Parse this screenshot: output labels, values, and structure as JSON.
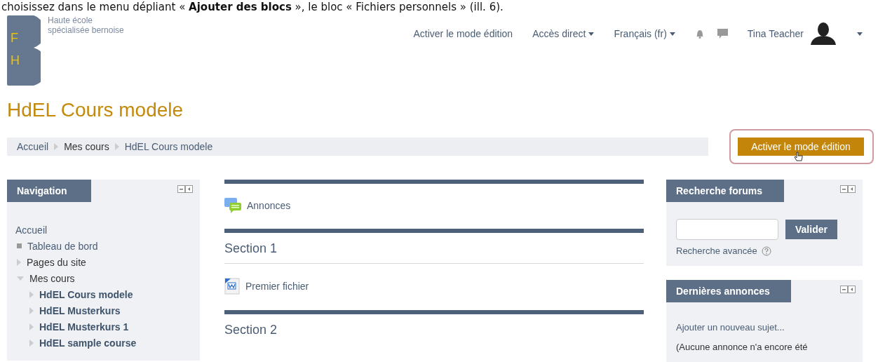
{
  "instruction_text": "choisissez dans le menu dépliant « **Ajouter des blocs** », le bloc « Fichiers personnels » (ill. 6).",
  "header": {
    "logo_letters": [
      "F",
      "H"
    ],
    "institution": [
      "Haute école",
      "spécialisée bernoise"
    ],
    "nav": [
      {
        "label": "Activer le mode édition",
        "dropdown": false
      },
      {
        "label": "Accès direct",
        "dropdown": true
      },
      {
        "label": "Français (fr)",
        "dropdown": true
      }
    ],
    "user_name": "Tina Teacher"
  },
  "page_title": "HdEL Cours modele",
  "breadcrumb": [
    {
      "label": "Accueil",
      "link": true
    },
    {
      "label": "Mes cours",
      "link": false
    },
    {
      "label": "HdEL Cours modele",
      "link": true
    }
  ],
  "edit_button": {
    "label": "Activer le mode édition",
    "highlighted": true
  },
  "navigation_block": {
    "title": "Navigation",
    "items": [
      {
        "label": "Accueil",
        "kind": "root"
      },
      {
        "label": "Tableau de bord",
        "kind": "leaf"
      },
      {
        "label": "Pages du site",
        "kind": "branch",
        "expanded": false
      },
      {
        "label": "Mes cours",
        "kind": "branch",
        "expanded": true,
        "children": [
          {
            "label": "HdEL Cours modele",
            "kind": "branch",
            "expanded": false
          },
          {
            "label": "HdEL Musterkurs",
            "kind": "branch",
            "expanded": false
          },
          {
            "label": "HdEL Musterkurs 1",
            "kind": "branch",
            "expanded": false
          },
          {
            "label": "HdEL sample course",
            "kind": "branch",
            "expanded": false
          }
        ]
      }
    ]
  },
  "sections": [
    {
      "activities": [
        {
          "label": "Annonces",
          "kind": "forum"
        }
      ]
    },
    {
      "title": "Section 1",
      "activities": [
        {
          "label": "Premier fichier",
          "kind": "word"
        }
      ]
    },
    {
      "title": "Section 2"
    }
  ],
  "search_block": {
    "title": "Recherche forums",
    "button": "Valider",
    "advanced_link": "Recherche avancée"
  },
  "news_block": {
    "title": "Dernières annonces",
    "add_link": "Ajouter un nouveau sujet...",
    "note": "(Aucune annonce n'a encore été"
  }
}
